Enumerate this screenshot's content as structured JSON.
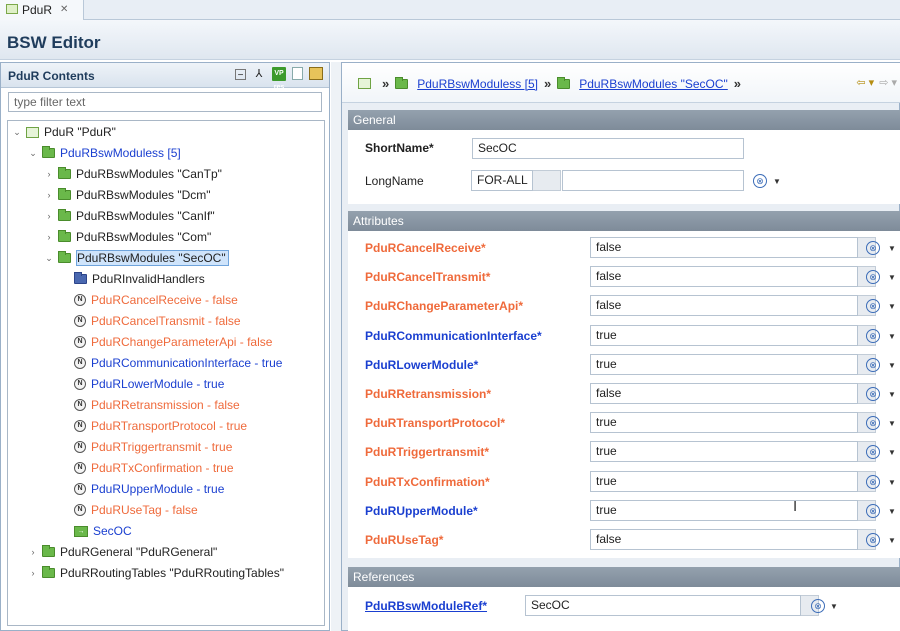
{
  "tab": {
    "title": "PduR",
    "close": "✕"
  },
  "editor": {
    "title": "BSW Editor"
  },
  "left": {
    "title": "PduR Contents",
    "filter_placeholder": "type filter text",
    "tree": [
      {
        "label": "PduR \"PduR\"",
        "twisty": "⌄",
        "icon": "module",
        "color": "dark"
      },
      {
        "label": "PduRBswModuless [5]",
        "twisty": "⌄",
        "icon": "folder",
        "color": "blue"
      },
      {
        "label": "PduRBswModules \"CanTp\"",
        "twisty": "›",
        "icon": "folder",
        "color": "dark"
      },
      {
        "label": "PduRBswModules \"Dcm\"",
        "twisty": "›",
        "icon": "folder",
        "color": "dark"
      },
      {
        "label": "PduRBswModules \"CanIf\"",
        "twisty": "›",
        "icon": "folder",
        "color": "dark"
      },
      {
        "label": "PduRBswModules \"Com\"",
        "twisty": "›",
        "icon": "folder",
        "color": "dark"
      },
      {
        "label": "PduRBswModules \"SecOC\"",
        "twisty": "⌄",
        "icon": "folder",
        "color": "dark",
        "selected": true
      },
      {
        "label": "PduRInvalidHandlers",
        "twisty": "",
        "icon": "folder-blue",
        "color": "dark"
      },
      {
        "label": "PduRCancelReceive - false",
        "twisty": "",
        "icon": "param",
        "color": "orange"
      },
      {
        "label": "PduRCancelTransmit - false",
        "twisty": "",
        "icon": "param",
        "color": "orange"
      },
      {
        "label": "PduRChangeParameterApi - false",
        "twisty": "",
        "icon": "param",
        "color": "orange"
      },
      {
        "label": "PduRCommunicationInterface - true",
        "twisty": "",
        "icon": "param",
        "color": "blue"
      },
      {
        "label": "PduRLowerModule - true",
        "twisty": "",
        "icon": "param",
        "color": "blue"
      },
      {
        "label": "PduRRetransmission - false",
        "twisty": "",
        "icon": "param",
        "color": "orange"
      },
      {
        "label": "PduRTransportProtocol - true",
        "twisty": "",
        "icon": "param",
        "color": "orange"
      },
      {
        "label": "PduRTriggertransmit - true",
        "twisty": "",
        "icon": "param",
        "color": "orange"
      },
      {
        "label": "PduRTxConfirmation - true",
        "twisty": "",
        "icon": "param",
        "color": "orange"
      },
      {
        "label": "PduRUpperModule - true",
        "twisty": "",
        "icon": "param",
        "color": "blue"
      },
      {
        "label": "PduRUseTag - false",
        "twisty": "",
        "icon": "param",
        "color": "orange"
      },
      {
        "label": "SecOC",
        "twisty": "",
        "icon": "ref",
        "color": "blue"
      },
      {
        "label": "PduRGeneral \"PduRGeneral\"",
        "twisty": "›",
        "icon": "folder",
        "color": "dark"
      },
      {
        "label": "PduRRoutingTables \"PduRRoutingTables\"",
        "twisty": "›",
        "icon": "folder",
        "color": "dark"
      }
    ],
    "icon_glyphs": {
      "param": "N",
      "ref": "→",
      "tb_green": "VP res"
    }
  },
  "breadcrumb": {
    "sep": "»",
    "item1": "PduRBswModuless [5]",
    "item2": "PduRBswModules \"SecOC\"",
    "nav_back": "⇦ ▾",
    "nav_fwd": "⇨ ▾"
  },
  "general": {
    "title": "General",
    "shortname_label": "ShortName*",
    "shortname_value": "SecOC",
    "longname_label": "LongName",
    "longname_lang": "FOR-ALL",
    "longname_value": ""
  },
  "attributes": {
    "title": "Attributes",
    "rows": [
      {
        "label": "PduRCancelReceive*",
        "value": "false",
        "color": "orange"
      },
      {
        "label": "PduRCancelTransmit*",
        "value": "false",
        "color": "orange"
      },
      {
        "label": "PduRChangeParameterApi*",
        "value": "false",
        "color": "orange"
      },
      {
        "label": "PduRCommunicationInterface*",
        "value": "true",
        "color": "blue"
      },
      {
        "label": "PduRLowerModule*",
        "value": "true",
        "color": "blue"
      },
      {
        "label": "PduRRetransmission*",
        "value": "false",
        "color": "orange"
      },
      {
        "label": "PduRTransportProtocol*",
        "value": "true",
        "color": "orange"
      },
      {
        "label": "PduRTriggertransmit*",
        "value": "true",
        "color": "orange"
      },
      {
        "label": "PduRTxConfirmation*",
        "value": "true",
        "color": "orange"
      },
      {
        "label": "PduRUpperModule*",
        "value": "true",
        "color": "blue"
      },
      {
        "label": "PduRUseTag*",
        "value": "false",
        "color": "orange"
      }
    ]
  },
  "references": {
    "title": "References",
    "ref_label": "PduRBswModuleRef*",
    "ref_value": "SecOC"
  },
  "colors": {
    "blue": "#1a3fd0",
    "orange": "#ef6a3b",
    "dark": "#222222"
  },
  "glyphs": {
    "reset": "⊗",
    "dropdown": "▼"
  }
}
